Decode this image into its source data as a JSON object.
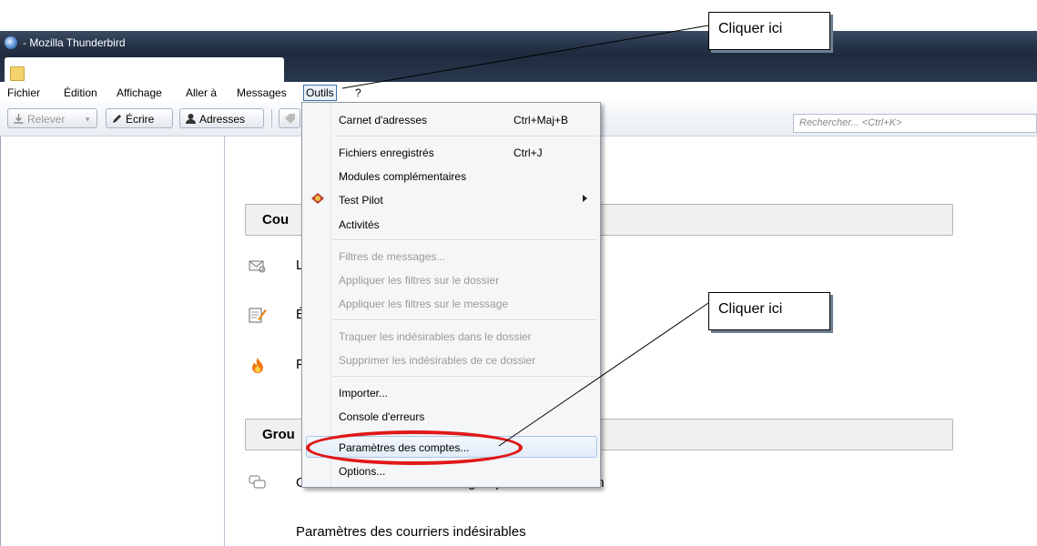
{
  "window": {
    "title": " - Mozilla Thunderbird"
  },
  "menubar": {
    "items": [
      "Fichier",
      "Édition",
      "Affichage",
      "Aller à",
      "Messages",
      "Outils",
      "?"
    ]
  },
  "toolbar": {
    "relever": "Relever",
    "ecrire": "Écrire",
    "adresses": "Adresses",
    "search_placeholder": "Rechercher... <Ctrl+K>"
  },
  "main": {
    "section1": "Cou",
    "section2": "Grou",
    "row1": "L",
    "row2": "É",
    "row3": "F",
    "row4": "Gérer les abonnements aux groupes de discussion",
    "row5": "Paramètres des courriers indésirables"
  },
  "outils_menu": {
    "items": [
      {
        "label": "Carnet d'adresses",
        "shortcut": "Ctrl+Maj+B",
        "enabled": true
      },
      {
        "label": "Fichiers enregistrés",
        "shortcut": "Ctrl+J",
        "enabled": true
      },
      {
        "label": "Modules complémentaires",
        "shortcut": "",
        "enabled": true
      },
      {
        "label": "Test Pilot",
        "shortcut": "",
        "enabled": true,
        "submenu": true
      },
      {
        "label": "Activités",
        "shortcut": "",
        "enabled": true
      },
      {
        "label": "Filtres de messages...",
        "shortcut": "",
        "enabled": false
      },
      {
        "label": "Appliquer les filtres sur le dossier",
        "shortcut": "",
        "enabled": false
      },
      {
        "label": "Appliquer les filtres sur le message",
        "shortcut": "",
        "enabled": false
      },
      {
        "label": "Traquer les indésirables dans le dossier",
        "shortcut": "",
        "enabled": false
      },
      {
        "label": "Supprimer les indésirables de ce dossier",
        "shortcut": "",
        "enabled": false
      },
      {
        "label": "Importer...",
        "shortcut": "",
        "enabled": true
      },
      {
        "label": "Console d'erreurs",
        "shortcut": "",
        "enabled": true
      },
      {
        "label": "Paramètres des comptes...",
        "shortcut": "",
        "enabled": true,
        "highlighted": true
      },
      {
        "label": "Options...",
        "shortcut": "",
        "enabled": true
      }
    ]
  },
  "annotations": {
    "callout1": "Cliquer ici",
    "callout2": "Cliquer ici",
    "highlight_color": "#e01818"
  }
}
